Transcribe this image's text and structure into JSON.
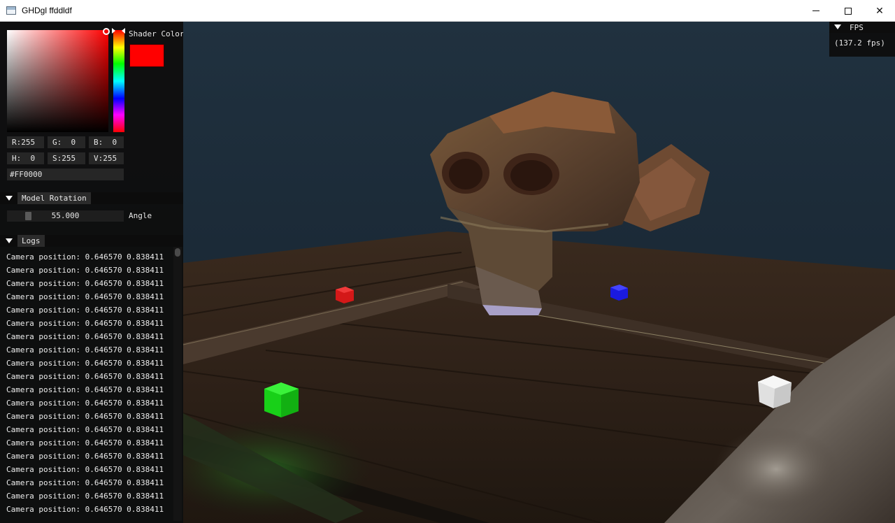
{
  "window": {
    "title": "GHDgl ffddldf",
    "minimize_glyph": "",
    "maximize_glyph": "",
    "close_glyph": "✕"
  },
  "color_picker": {
    "label": "Shader Color",
    "current_color": "#ff0000",
    "r": "R:255",
    "g": "G:  0",
    "b": "B:  0",
    "h": "H:  0",
    "s": "S:255",
    "v": "V:255",
    "hex": "#FF0000"
  },
  "model_rotation": {
    "header": "Model Rotation",
    "value": "55.000",
    "value_fraction": 0.153,
    "label": "Angle"
  },
  "logs": {
    "header": "Logs",
    "lines": [
      "Camera position: 0.646570 0.838411",
      "Camera position: 0.646570 0.838411",
      "Camera position: 0.646570 0.838411",
      "Camera position: 0.646570 0.838411",
      "Camera position: 0.646570 0.838411",
      "Camera position: 0.646570 0.838411",
      "Camera position: 0.646570 0.838411",
      "Camera position: 0.646570 0.838411",
      "Camera position: 0.646570 0.838411",
      "Camera position: 0.646570 0.838411",
      "Camera position: 0.646570 0.838411",
      "Camera position: 0.646570 0.838411",
      "Camera position: 0.646570 0.838411",
      "Camera position: 0.646570 0.838411",
      "Camera position: 0.646570 0.838411",
      "Camera position: 0.646570 0.838411",
      "Camera position: 0.646570 0.838411",
      "Camera position: 0.646570 0.838411",
      "Camera position: 0.646570 0.838411",
      "Camera position: 0.646570 0.838411"
    ]
  },
  "fps": {
    "header": "FPS",
    "value": "(137.2 fps)"
  },
  "scene": {
    "light_colors": {
      "red": "#e01c1c",
      "blue": "#1a1ae8",
      "green": "#1ee01e",
      "white": "#e8e8e8"
    }
  }
}
